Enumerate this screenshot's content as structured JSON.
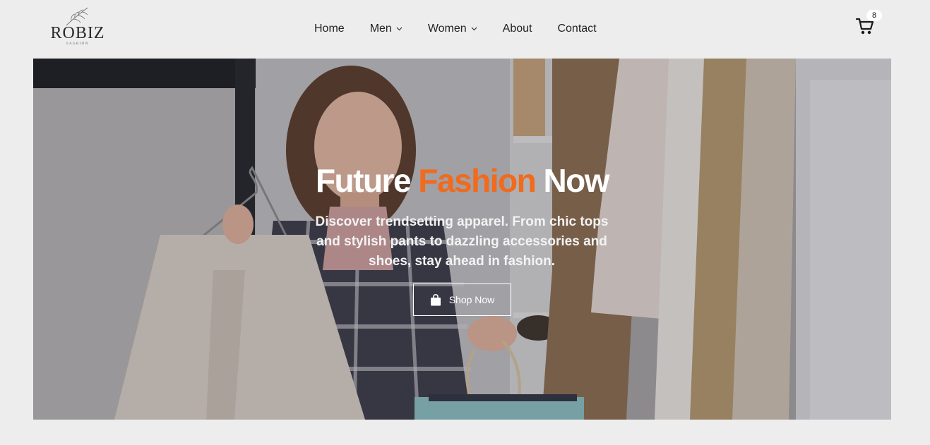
{
  "brand": {
    "name": "ROBIZ",
    "tagline": "FASHION"
  },
  "nav": {
    "items": [
      {
        "label": "Home",
        "dropdown": false
      },
      {
        "label": "Men",
        "dropdown": true
      },
      {
        "label": "Women",
        "dropdown": true
      },
      {
        "label": "About",
        "dropdown": false
      },
      {
        "label": "Contact",
        "dropdown": false
      }
    ]
  },
  "cart": {
    "icon": "cart-icon",
    "count": "8"
  },
  "hero": {
    "title_part1": "Future ",
    "title_accent": "Fashion",
    "title_part2": " Now",
    "description": "Discover trendsetting apparel. From chic tops and stylish pants to dazzling accessories and shoes, stay ahead in fashion.",
    "button_label": "Shop Now",
    "button_icon": "shopping-bag-icon"
  },
  "colors": {
    "accent": "#f26a1b",
    "background": "#ededed",
    "text": "#222222"
  }
}
